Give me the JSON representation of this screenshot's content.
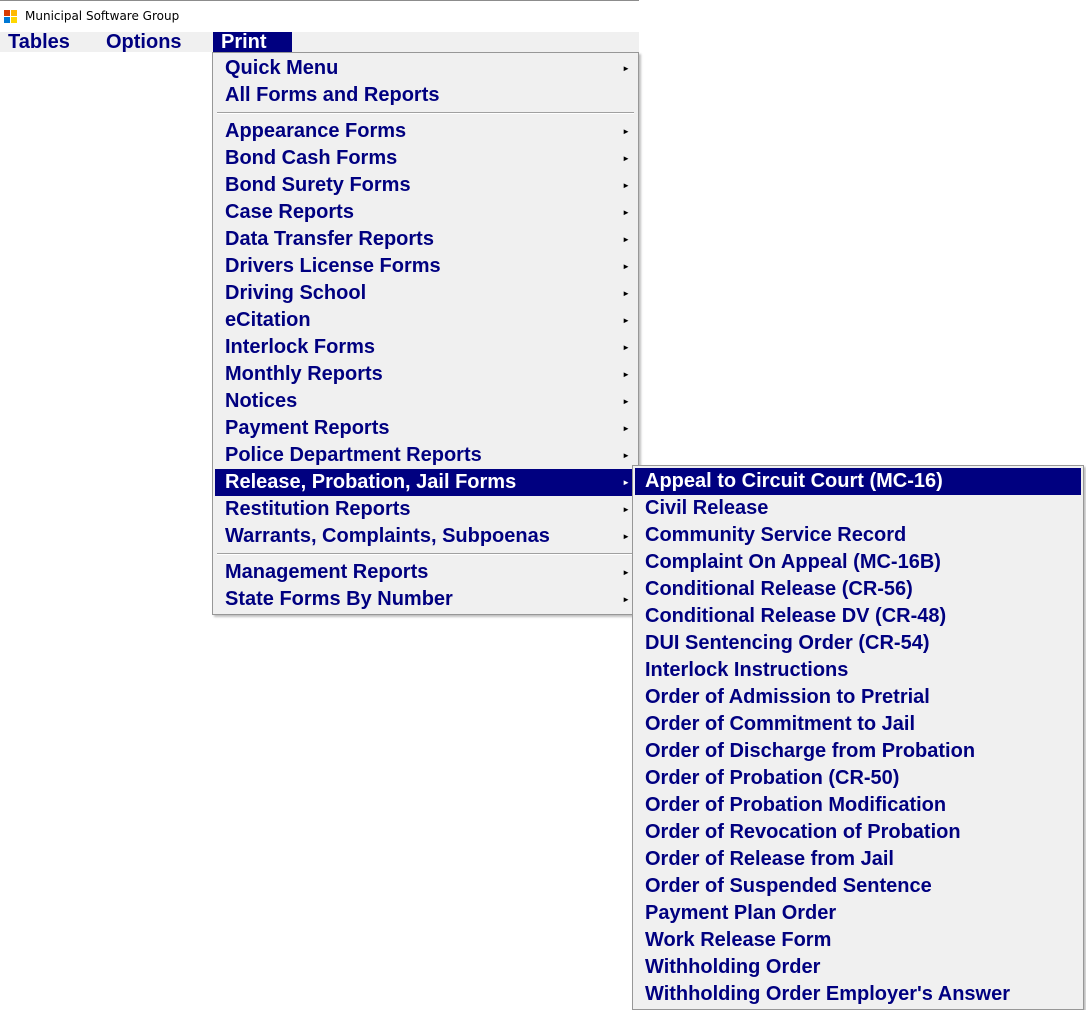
{
  "window": {
    "title": "Municipal Software Group",
    "icon": "app-window-icon"
  },
  "menubar": {
    "items": [
      {
        "label": "Tables"
      },
      {
        "label": "Options"
      },
      {
        "label": "Print",
        "active": true
      }
    ]
  },
  "print_menu": {
    "items": [
      {
        "label": "Quick Menu",
        "has_submenu": true
      },
      {
        "label": "All Forms and Reports",
        "has_submenu": false
      },
      {
        "label": "Appearance Forms",
        "has_submenu": true
      },
      {
        "label": "Bond Cash Forms",
        "has_submenu": true
      },
      {
        "label": "Bond Surety Forms",
        "has_submenu": true
      },
      {
        "label": "Case Reports",
        "has_submenu": true
      },
      {
        "label": "Data Transfer Reports",
        "has_submenu": true
      },
      {
        "label": "Drivers License Forms",
        "has_submenu": true
      },
      {
        "label": "Driving School",
        "has_submenu": true
      },
      {
        "label": "eCitation",
        "has_submenu": true
      },
      {
        "label": "Interlock Forms",
        "has_submenu": true
      },
      {
        "label": "Monthly Reports",
        "has_submenu": true
      },
      {
        "label": "Notices",
        "has_submenu": true
      },
      {
        "label": "Payment Reports",
        "has_submenu": true
      },
      {
        "label": "Police Department Reports",
        "has_submenu": true
      },
      {
        "label": "Release, Probation, Jail Forms",
        "has_submenu": true,
        "highlighted": true
      },
      {
        "label": "Restitution Reports",
        "has_submenu": true
      },
      {
        "label": "Warrants, Complaints, Subpoenas",
        "has_submenu": true
      },
      {
        "label": "Management Reports",
        "has_submenu": true
      },
      {
        "label": "State Forms By Number",
        "has_submenu": true
      }
    ],
    "submenu_arrow": "►"
  },
  "release_submenu": {
    "items": [
      {
        "label": "Appeal to Circuit Court (MC-16)",
        "highlighted": true
      },
      {
        "label": "Civil Release"
      },
      {
        "label": "Community Service Record"
      },
      {
        "label": "Complaint On Appeal (MC-16B)"
      },
      {
        "label": "Conditional Release (CR-56)"
      },
      {
        "label": "Conditional Release DV (CR-48)"
      },
      {
        "label": "DUI Sentencing Order (CR-54)"
      },
      {
        "label": "Interlock Instructions"
      },
      {
        "label": "Order of Admission to Pretrial"
      },
      {
        "label": "Order of Commitment to Jail"
      },
      {
        "label": "Order of Discharge from Probation"
      },
      {
        "label": "Order of Probation (CR-50)"
      },
      {
        "label": "Order of Probation Modification"
      },
      {
        "label": "Order of Revocation of Probation"
      },
      {
        "label": "Order of Release from Jail"
      },
      {
        "label": "Order of Suspended Sentence"
      },
      {
        "label": "Payment Plan Order"
      },
      {
        "label": "Work Release Form"
      },
      {
        "label": "Withholding Order"
      },
      {
        "label": "Withholding Order Employer's Answer"
      }
    ]
  },
  "colors": {
    "menu_text": "#000080",
    "highlight_bg": "#000080",
    "highlight_text": "#ffffff",
    "menu_bg": "#f0f0f0"
  }
}
